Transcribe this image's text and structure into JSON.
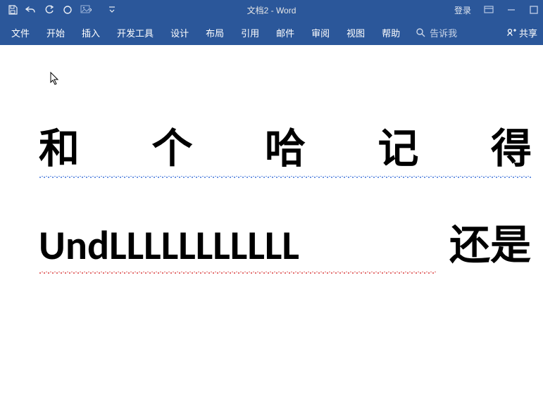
{
  "title": "文档2  -  Word",
  "account": {
    "login": "登录"
  },
  "ribbon": {
    "tabs": [
      "文件",
      "开始",
      "插入",
      "开发工具",
      "设计",
      "布局",
      "引用",
      "邮件",
      "审阅",
      "视图",
      "帮助"
    ],
    "tell_me": "告诉我",
    "share": "共享"
  },
  "document": {
    "line1_chars": [
      "和",
      "个",
      "哈",
      "记",
      "得"
    ],
    "line2_en": "UndLLLLLLLLLLL",
    "line2_cn": "还是"
  }
}
